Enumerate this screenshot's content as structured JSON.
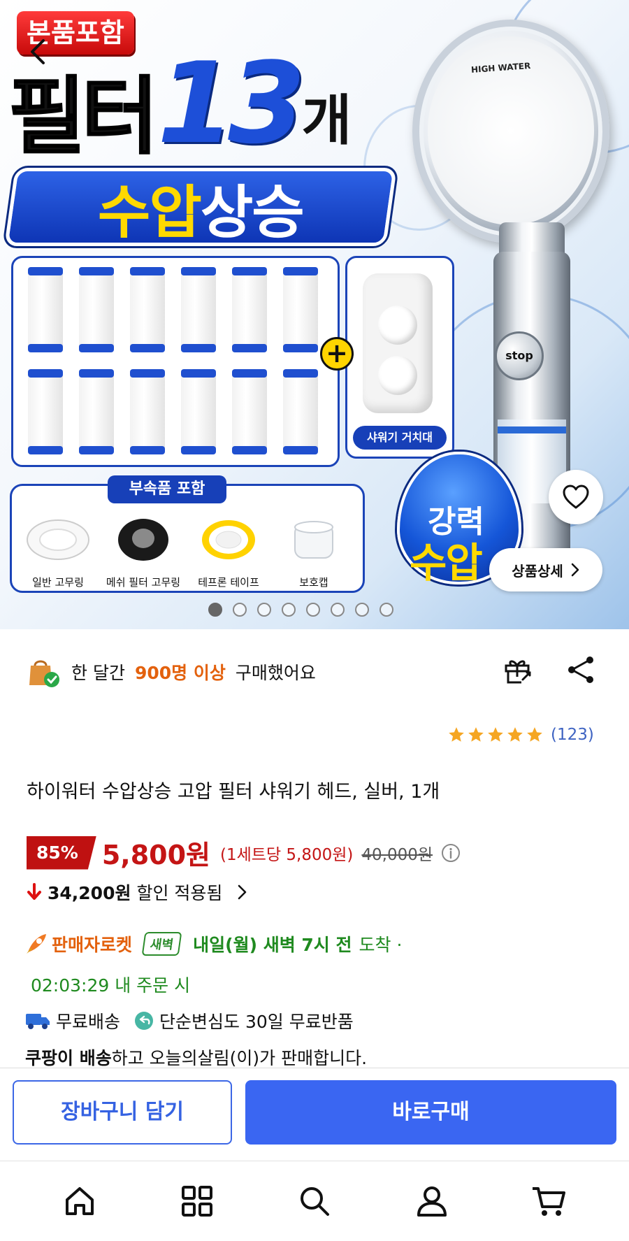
{
  "hero": {
    "badge_bonpum": "본품포함",
    "headline_a": "필터",
    "headline_num": "13",
    "headline_b": "개",
    "banner_yellow": "수압",
    "banner_white": "상승",
    "holder_label": "샤워기 거치대",
    "plus": "+",
    "accessories_title": "부속품 포함",
    "accessories": [
      "일반 고무링",
      "메쉬 필터 고무링",
      "테프론 테이프",
      "보호캡"
    ],
    "showerhead_brand": "HIGH WATER",
    "stop_label": "stop",
    "drop_line1": "강력",
    "drop_line2": "수압",
    "detail_button": "상품상세",
    "pagination": {
      "total": 8,
      "active": 1
    }
  },
  "info": {
    "buyers_prefix": "한 달간",
    "buyers_highlight": "900명 이상",
    "buyers_suffix": "구매했어요",
    "rating_stars": 5,
    "rating_count": "(123)",
    "title": "하이워터 수압상승 고압 필터 샤워기 헤드, 실버, 1개",
    "discount": "85%",
    "sale_price": "5,800원",
    "unit_price": "(1세트당 5,800원)",
    "original_price": "40,000원",
    "saved_amount": "34,200원",
    "saved_text": "할인 적용됨",
    "rocket_brand": "판매자로켓",
    "dawn_badge": "새벽",
    "arrival": "내일(월) 새벽 7시 전",
    "arrival_tail": "도착 ·",
    "countdown": "02:03:29 내 주문 시",
    "free_shipping": "무료배송",
    "free_return": "단순변심도 30일 무료반품",
    "seller_bold": "쿠팡이 배송",
    "seller_rest": "하고 오늘의살림(이)가 판매합니다."
  },
  "actions": {
    "cart": "장바구니 담기",
    "buy": "바로구매"
  },
  "colors": {
    "accent_blue": "#3a66f2",
    "price_red": "#c41515",
    "highlight_orange": "#e3610d",
    "delivery_green": "#1f8a1f",
    "star": "#f5a623"
  }
}
